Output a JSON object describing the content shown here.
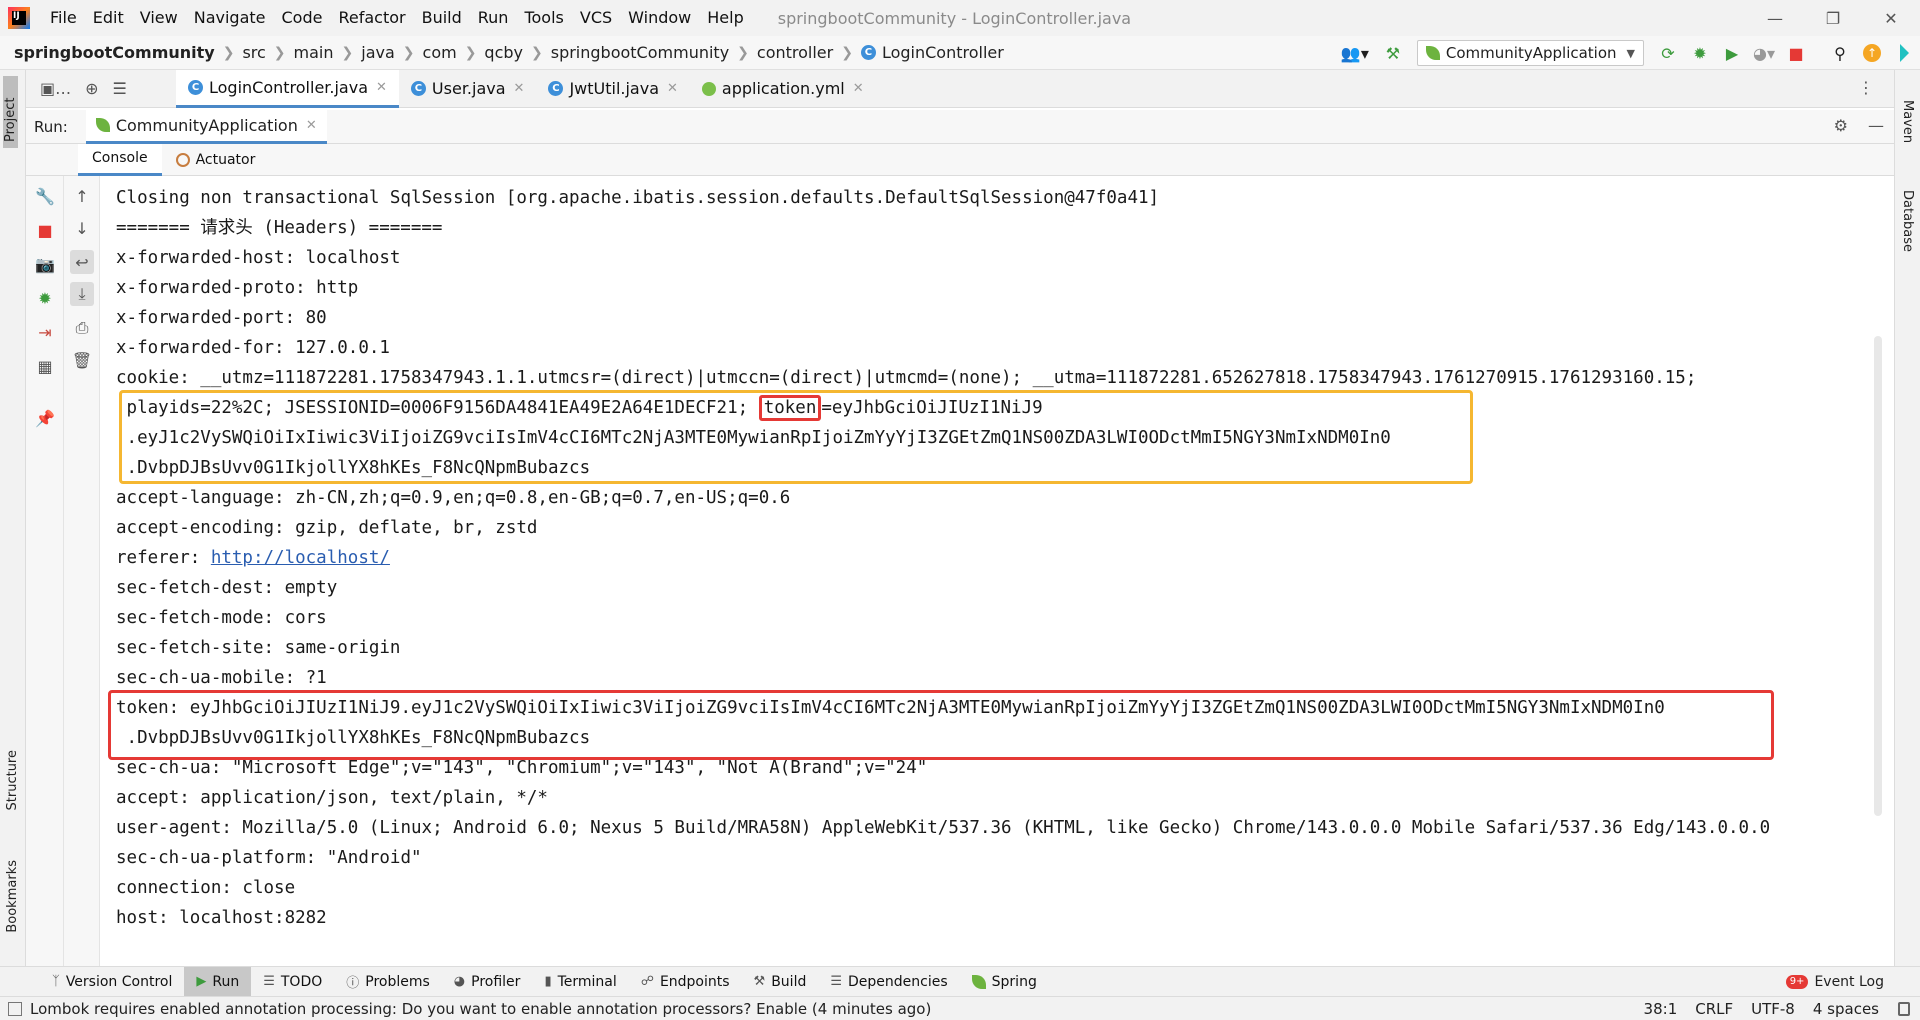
{
  "menu": {
    "items": [
      "File",
      "Edit",
      "View",
      "Navigate",
      "Code",
      "Refactor",
      "Build",
      "Run",
      "Tools",
      "VCS",
      "Window",
      "Help"
    ],
    "window_title": "springbootCommunity - LoginController.java"
  },
  "breadcrumb": [
    "springbootCommunity",
    "src",
    "main",
    "java",
    "com",
    "qcby",
    "springbootCommunity",
    "controller",
    "LoginController"
  ],
  "run_config": "CommunityApplication",
  "editor_tabs": [
    {
      "label": "LoginController.java",
      "icon": "class-icon",
      "active": true
    },
    {
      "label": "User.java",
      "icon": "class-icon",
      "active": false
    },
    {
      "label": "JwtUtil.java",
      "icon": "class-icon",
      "active": false
    },
    {
      "label": "application.yml",
      "icon": "yaml-icon",
      "active": false
    }
  ],
  "run_window": {
    "label": "Run:",
    "tab": "CommunityApplication",
    "subtabs": [
      "Console",
      "Actuator"
    ]
  },
  "side_tabs": {
    "left_top": "Project",
    "left_structure": "Structure",
    "left_bookmarks": "Bookmarks",
    "right_maven": "Maven",
    "right_database": "Database"
  },
  "console": {
    "lines": [
      "Closing non transactional SqlSession [org.apache.ibatis.session.defaults.DefaultSqlSession@47f0a41]",
      "======= 请求头 (Headers) =======",
      "x-forwarded-host: localhost",
      "x-forwarded-proto: http",
      "x-forwarded-port: 80",
      "x-forwarded-for: 127.0.0.1",
      "cookie: __utmz=111872281.1758347943.1.1.utmcsr=(direct)|utmccn=(direct)|utmcmd=(none); __utma=111872281.652627818.1758347943.1761270915.1761293160.15;",
      " playids=22%2C; JSESSIONID=0006F9156DA4841EA49E2A64E1DECF21; ",
      " .eyJ1c2VySWQiOiIxIiwic3ViIjoiZG9vciIsImV4cCI6MTc2NjA3MTE0MywianRpIjoiZmYyYjI3ZGEtZmQ1NS00ZDA3LWI0ODctMmI5NGY3NmIxNDM0In0",
      " .DvbpDJBsUvv0G1IkjollYX8hKEs_F8NcQNpmBubazcs",
      "accept-language: zh-CN,zh;q=0.9,en;q=0.8,en-GB;q=0.7,en-US;q=0.6",
      "accept-encoding: gzip, deflate, br, zstd",
      "referer: ",
      "sec-fetch-dest: empty",
      "sec-fetch-mode: cors",
      "sec-fetch-site: same-origin",
      "sec-ch-ua-mobile: ?1",
      "token: eyJhbGciOiJIUzI1NiJ9.eyJ1c2VySWQiOiIxIiwic3ViIjoiZG9vciIsImV4cCI6MTc2NjA3MTE0MywianRpIjoiZmYyYjI3ZGEtZmQ1NS00ZDA3LWI0ODctMmI5NGY3NmIxNDM0In0",
      " .DvbpDJBsUvv0G1IkjollYX8hKEs_F8NcQNpmBubazcs",
      "sec-ch-ua: \"Microsoft Edge\";v=\"143\", \"Chromium\";v=\"143\", \"Not A(Brand\";v=\"24\"",
      "accept: application/json, text/plain, */*",
      "user-agent: Mozilla/5.0 (Linux; Android 6.0; Nexus 5 Build/MRA58N) AppleWebKit/537.36 (KHTML, like Gecko) Chrome/143.0.0.0 Mobile Safari/537.36 Edg/143.0.0.0",
      "sec-ch-ua-platform: \"Android\"",
      "connection: close",
      "host: localhost:8282"
    ],
    "cookie_token_key": "token",
    "cookie_token_value": "=eyJhbGciOiJIUzI1NiJ9",
    "referer_link": "http://localhost/"
  },
  "bottom_tools": [
    {
      "label": "Version Control",
      "icon": "branch-icon",
      "active": false
    },
    {
      "label": "Run",
      "icon": "play-icon",
      "active": true
    },
    {
      "label": "TODO",
      "icon": "list-icon",
      "active": false
    },
    {
      "label": "Problems",
      "icon": "info-icon",
      "active": false
    },
    {
      "label": "Profiler",
      "icon": "profiler-icon",
      "active": false
    },
    {
      "label": "Terminal",
      "icon": "terminal-icon",
      "active": false
    },
    {
      "label": "Endpoints",
      "icon": "endpoints-icon",
      "active": false
    },
    {
      "label": "Build",
      "icon": "hammer-icon",
      "active": false
    },
    {
      "label": "Dependencies",
      "icon": "layers-icon",
      "active": false
    },
    {
      "label": "Spring",
      "icon": "spring-icon",
      "active": false
    }
  ],
  "event_log": {
    "badge": "9+",
    "label": "Event Log"
  },
  "status": {
    "message": "Lombok requires enabled annotation processing: Do you want to enable annotation processors? Enable (4 minutes ago)",
    "position": "38:1",
    "line_sep": "CRLF",
    "encoding": "UTF-8",
    "indent": "4 spaces"
  },
  "colors": {
    "accent": "#4a88c7",
    "highlight_orange": "#f5b731",
    "highlight_red": "#e53935"
  }
}
